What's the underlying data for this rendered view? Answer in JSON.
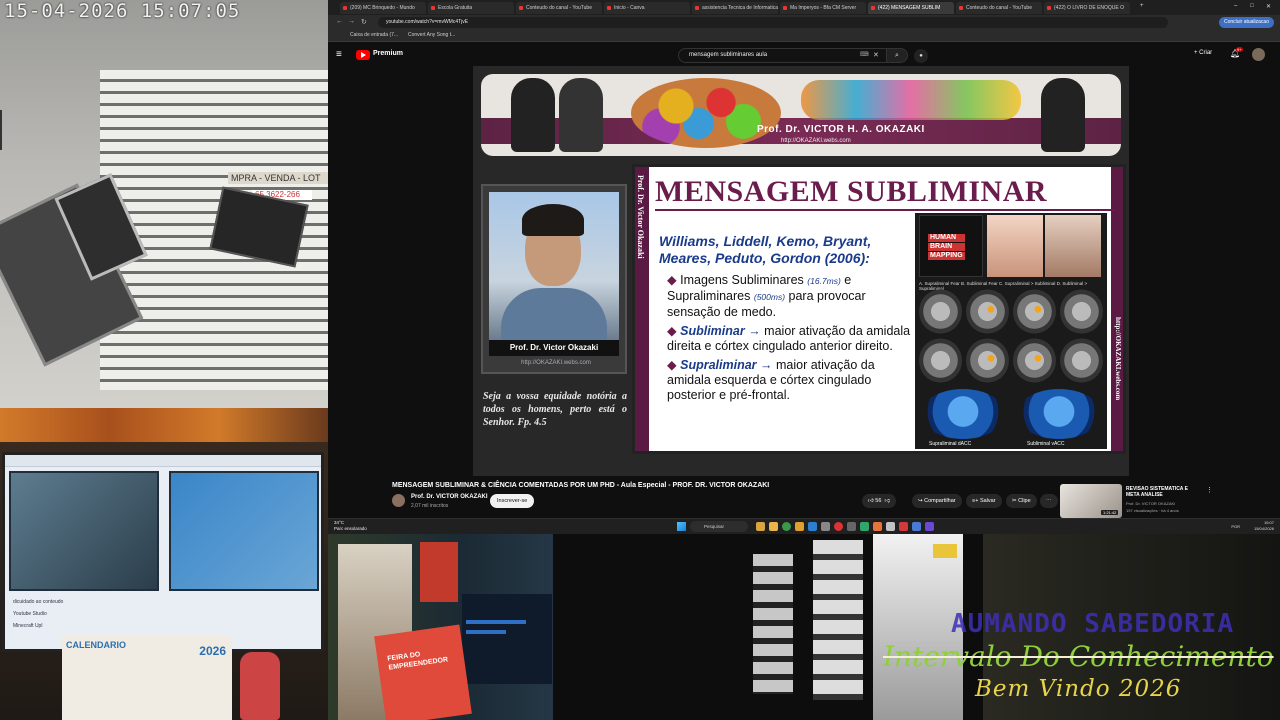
{
  "camera_left": {
    "timestamp": "15-04-2026 15:07:05",
    "sign_text": "MPRA - VENDA - LOT",
    "sign_phone": "65 3622-266"
  },
  "monitor_feed": {
    "line1": "dicuidado ao conteudo",
    "line2": "Youtube Studio",
    "line3": "Minecraft Upl",
    "calendar_title": "CALENDARIO",
    "calendar_year": "2026"
  },
  "browser": {
    "tabs": [
      "(209) MC Brinquedo - Mundo",
      "Escola Gratuita",
      "Conteudo do canal - YouTube",
      "Inicio - Canva",
      "assistencia Tecnica de Informatica",
      "Ma Imperyos - Bfa CM Server",
      "(422) MENSAGEM SUBLIM",
      "Conteudo do canal - YouTube",
      "(422) O LIVRO DE ENOQUE O"
    ],
    "url": "youtube.com/watch?v=mvWMc4TjvE",
    "update_button": "Concluir atualizacao",
    "bookmarks": [
      "Caixa de entrada (7...",
      "Convert Any Song t..."
    ]
  },
  "youtube": {
    "brand": "Premium",
    "search_query": "mensagem subliminares aula",
    "create_label": "Criar",
    "notifications": "9+",
    "video_title": "MENSAGEM SUBLIMINAR & CIÊNCIA COMENTADAS POR UM PHD - Aula Especial - PROF. DR. VICTOR OKAZAKI",
    "channel_name": "Prof. Dr. VICTOR OKAZAKI",
    "channel_subs": "2,07 mil inscritos",
    "subscribe_label": "Inscrever-se",
    "like_count": "56",
    "share_label": "Compartilhar",
    "save_label": "Salvar",
    "clip_label": "Clipe",
    "recommended": {
      "title": "REVISAO SISTEMATICA E META ANALISE",
      "channel": "Prof. Dr. VICTOR OKAZAKI",
      "meta": "197 visualizações · há 4 anos",
      "duration": "1:21:42"
    }
  },
  "video_frame": {
    "banner_name": "Prof. Dr. VICTOR H. A. OKAZAKI",
    "banner_url": "http://OKAZAKI.webs.com",
    "photo_name": "Prof. Dr. Victor Okazaki",
    "photo_url": "http://OKAZAKI.webs.com",
    "quote": "Seja a vossa equidade notória a todos os homens, perto está o Senhor. Fp. 4.5",
    "slide": {
      "side_text": "Prof. Dr. Victor Okazaki",
      "side_right": "http://OKAZAKI.webs.com",
      "title": "MENSAGEM SUBLIMINAR",
      "authors": "Williams, Liddell, Kemo, Bryant, Meares, Peduto, Gordon (2006):",
      "bullet1_a": "Imagens Subliminares",
      "bullet1_ms1": "(16.7ms)",
      "bullet1_b": "e Supraliminares",
      "bullet1_ms2": "(500ms)",
      "bullet1_c": "para provocar sensação de medo.",
      "bullet2_term": "Subliminar",
      "bullet2_text": "maior ativação da amidala direita e córtex cingulado anterior direito.",
      "bullet3_term": "Supraliminar",
      "bullet3_text": "maior ativação da amidala esquerda e córtex cingulado posterior e pré-frontal.",
      "book_lines": [
        "HUMAN",
        "BRAIN",
        "MAPPING"
      ],
      "fig_labels": "A. Supraliminal Fear    B. Subliminal Fear    C. Supraliminal > Subliminal    D. Subliminal > Supraliminal",
      "cap_left": "Supraliminal dACC",
      "cap_right": "Subliminal vACC"
    }
  },
  "taskbar": {
    "weather_temp": "34°C",
    "weather_desc": "Parc ensolarado",
    "search": "Pesquisar",
    "lang": "POR",
    "time": "15:07",
    "date": "15/04/2026"
  },
  "desk_feed": {
    "sign_text": "FEIRA DO EMPREENDEDOR"
  },
  "overlay": {
    "line1": "AUMANDO SABEDORIA",
    "line2": "Intervalo Do Conhecimento",
    "line3": "Bem Vindo 2026"
  }
}
